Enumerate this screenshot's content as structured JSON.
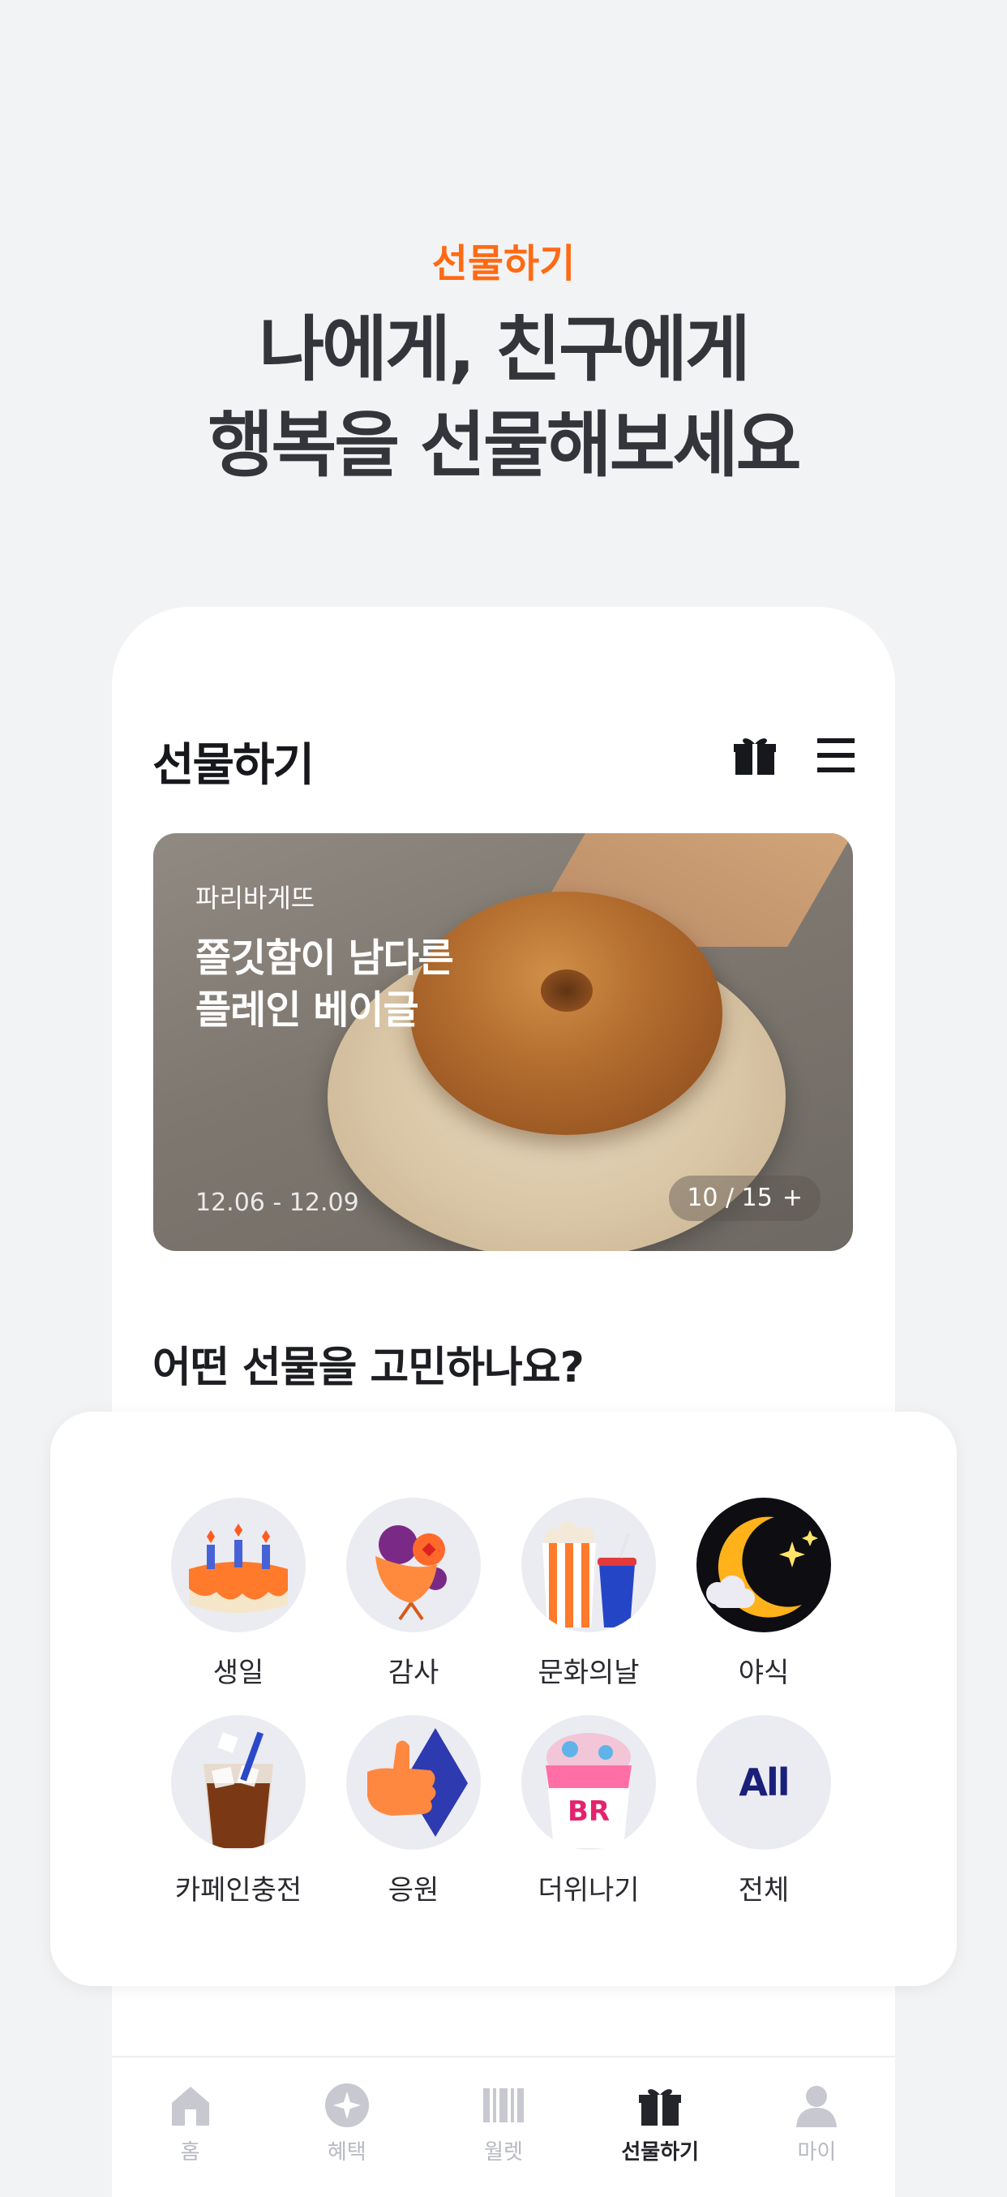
{
  "hero": {
    "tag": "선물하기",
    "title_line1": "나에게, 친구에게",
    "title_line2": "행복을 선물해보세요"
  },
  "app": {
    "title": "선물하기",
    "icons": [
      "gift-icon",
      "menu-icon"
    ]
  },
  "banner": {
    "brand": "파리바게뜨",
    "headline_line1": "쫄깃함이 남다른",
    "headline_line2": "플레인 베이글",
    "date": "12.06 - 12.09",
    "pager": "10 / 15",
    "pager_plus": "+"
  },
  "section": {
    "title": "어떤 선물을 고민하나요?"
  },
  "categories": [
    {
      "label": "생일",
      "icon": "birthday-cake-icon"
    },
    {
      "label": "감사",
      "icon": "bouquet-icon"
    },
    {
      "label": "문화의날",
      "icon": "popcorn-icon"
    },
    {
      "label": "야식",
      "icon": "moon-icon"
    },
    {
      "label": "카페인충전",
      "icon": "iced-coffee-icon"
    },
    {
      "label": "응원",
      "icon": "thumbs-up-icon"
    },
    {
      "label": "더위나기",
      "icon": "ice-cream-icon"
    },
    {
      "label": "전체",
      "icon": "all-icon",
      "badge": "All"
    }
  ],
  "tabs": [
    {
      "label": "홈",
      "icon": "home-icon",
      "active": false
    },
    {
      "label": "혜택",
      "icon": "benefit-icon",
      "active": false
    },
    {
      "label": "월렛",
      "icon": "wallet-barcode-icon",
      "active": false
    },
    {
      "label": "선물하기",
      "icon": "gift-icon",
      "active": true
    },
    {
      "label": "마이",
      "icon": "profile-icon",
      "active": false
    }
  ],
  "colors": {
    "accent": "#ff6a13",
    "background": "#f2f3f5",
    "tab_inactive": "#b7b9c2",
    "tab_active": "#24252b"
  }
}
